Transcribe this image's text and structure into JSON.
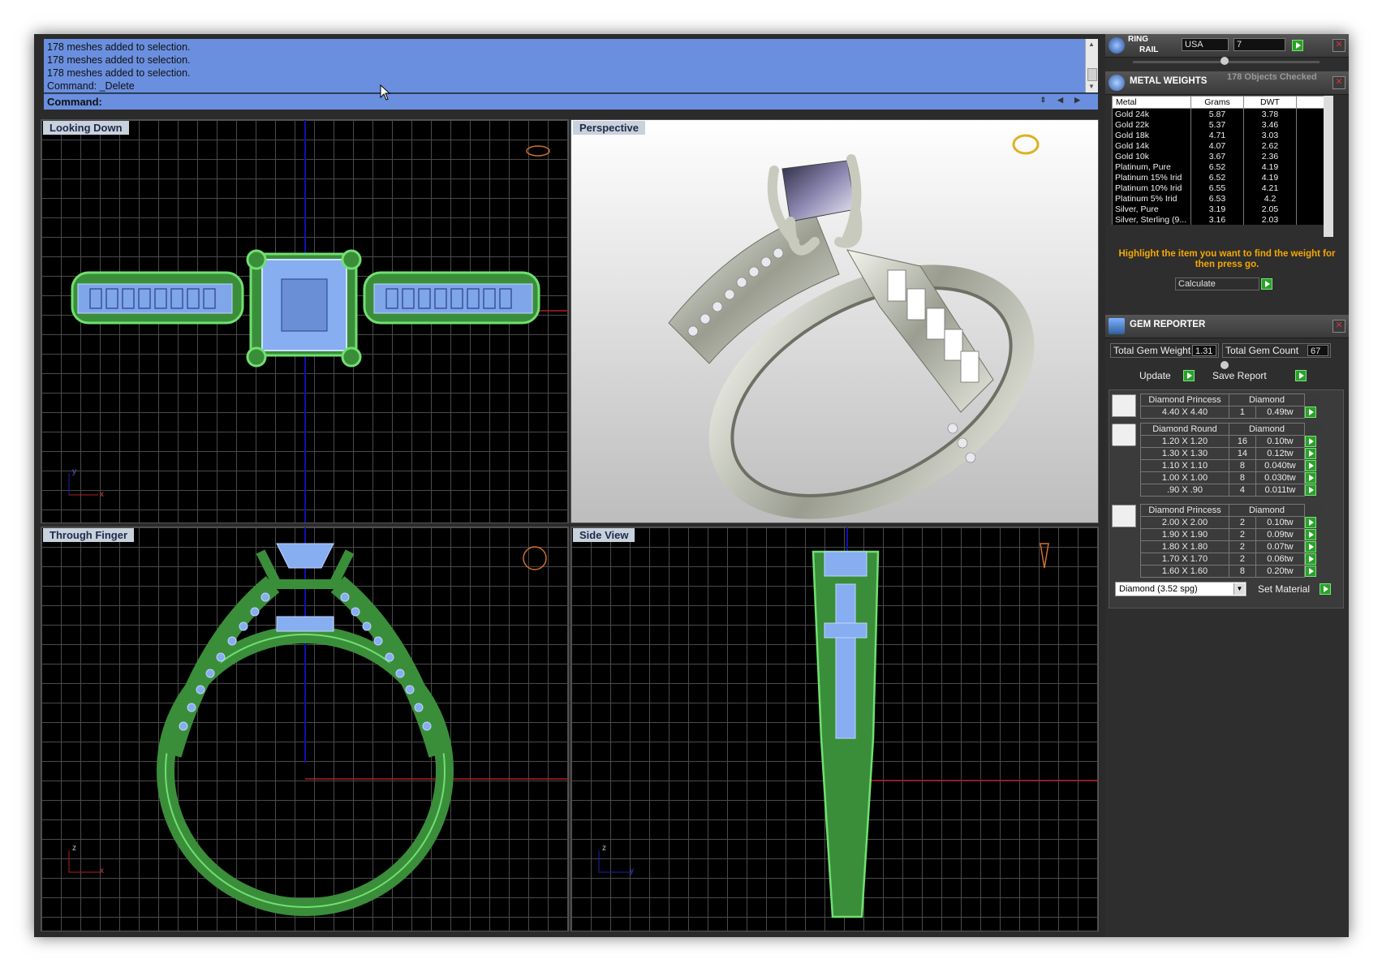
{
  "command": {
    "history": [
      "178 meshes added to selection.",
      "178 meshes added to selection.",
      "178 meshes added to selection.",
      "Command: _Delete"
    ],
    "prompt": "Command:"
  },
  "viewports": {
    "top_left": "Looking Down",
    "top_right": "Perspective",
    "bottom_left": "Through Finger",
    "bottom_right": "Side View"
  },
  "axes": {
    "x": "x",
    "y": "y",
    "z": "z"
  },
  "ring_rail": {
    "title_line1": "RING",
    "title_line2": "RAIL",
    "country": "USA",
    "size": "7"
  },
  "metal_weights": {
    "title": "METAL WEIGHTS",
    "status": "178 Objects Checked",
    "columns": [
      "Metal",
      "Grams",
      "DWT"
    ],
    "rows": [
      [
        "Gold 24k",
        "5.87",
        "3.78"
      ],
      [
        "Gold 22k",
        "5.37",
        "3.46"
      ],
      [
        "Gold 18k",
        "4.71",
        "3.03"
      ],
      [
        "Gold 14k",
        "4.07",
        "2.62"
      ],
      [
        "Gold 10k",
        "3.67",
        "2.36"
      ],
      [
        "Platinum, Pure",
        "6.52",
        "4.19"
      ],
      [
        "Platinum 15% Irid",
        "6.52",
        "4.19"
      ],
      [
        "Platinum 10% Irid",
        "6.55",
        "4.21"
      ],
      [
        "Platinum 5% Irid",
        "6.53",
        "4.2"
      ],
      [
        "Silver, Pure",
        "3.19",
        "2.05"
      ],
      [
        "Silver, Sterling (9...",
        "3.16",
        "2.03"
      ]
    ],
    "hint": "Highlight the item you want to find the weight for then press go.",
    "calculate_label": "Calculate"
  },
  "gem_reporter": {
    "title": "GEM REPORTER",
    "total_weight_label": "Total Gem Weight",
    "total_weight": "1.31",
    "total_count_label": "Total Gem Count",
    "total_count": "67",
    "update_label": "Update",
    "save_label": "Save Report",
    "groups": [
      {
        "shape": "Diamond Princess",
        "material": "Diamond",
        "rows": [
          [
            "4.40 X 4.40",
            "1",
            "0.49tw"
          ]
        ]
      },
      {
        "shape": "Diamond Round",
        "material": "Diamond",
        "rows": [
          [
            "1.20 X 1.20",
            "16",
            "0.10tw"
          ],
          [
            "1.30 X 1.30",
            "14",
            "0.12tw"
          ],
          [
            "1.10 X 1.10",
            "8",
            "0.040tw"
          ],
          [
            "1.00 X 1.00",
            "8",
            "0.030tw"
          ],
          [
            ".90 X .90",
            "4",
            "0.011tw"
          ]
        ]
      },
      {
        "shape": "Diamond Princess",
        "material": "Diamond",
        "rows": [
          [
            "2.00 X 2.00",
            "2",
            "0.10tw"
          ],
          [
            "1.90 X 1.90",
            "2",
            "0.09tw"
          ],
          [
            "1.80 X 1.80",
            "2",
            "0.07tw"
          ],
          [
            "1.70 X 1.70",
            "2",
            "0.06tw"
          ],
          [
            "1.60 X 1.60",
            "8",
            "0.20tw"
          ]
        ]
      }
    ],
    "material_select": "Diamond     (3.52 spg)",
    "set_material_label": "Set Material"
  }
}
